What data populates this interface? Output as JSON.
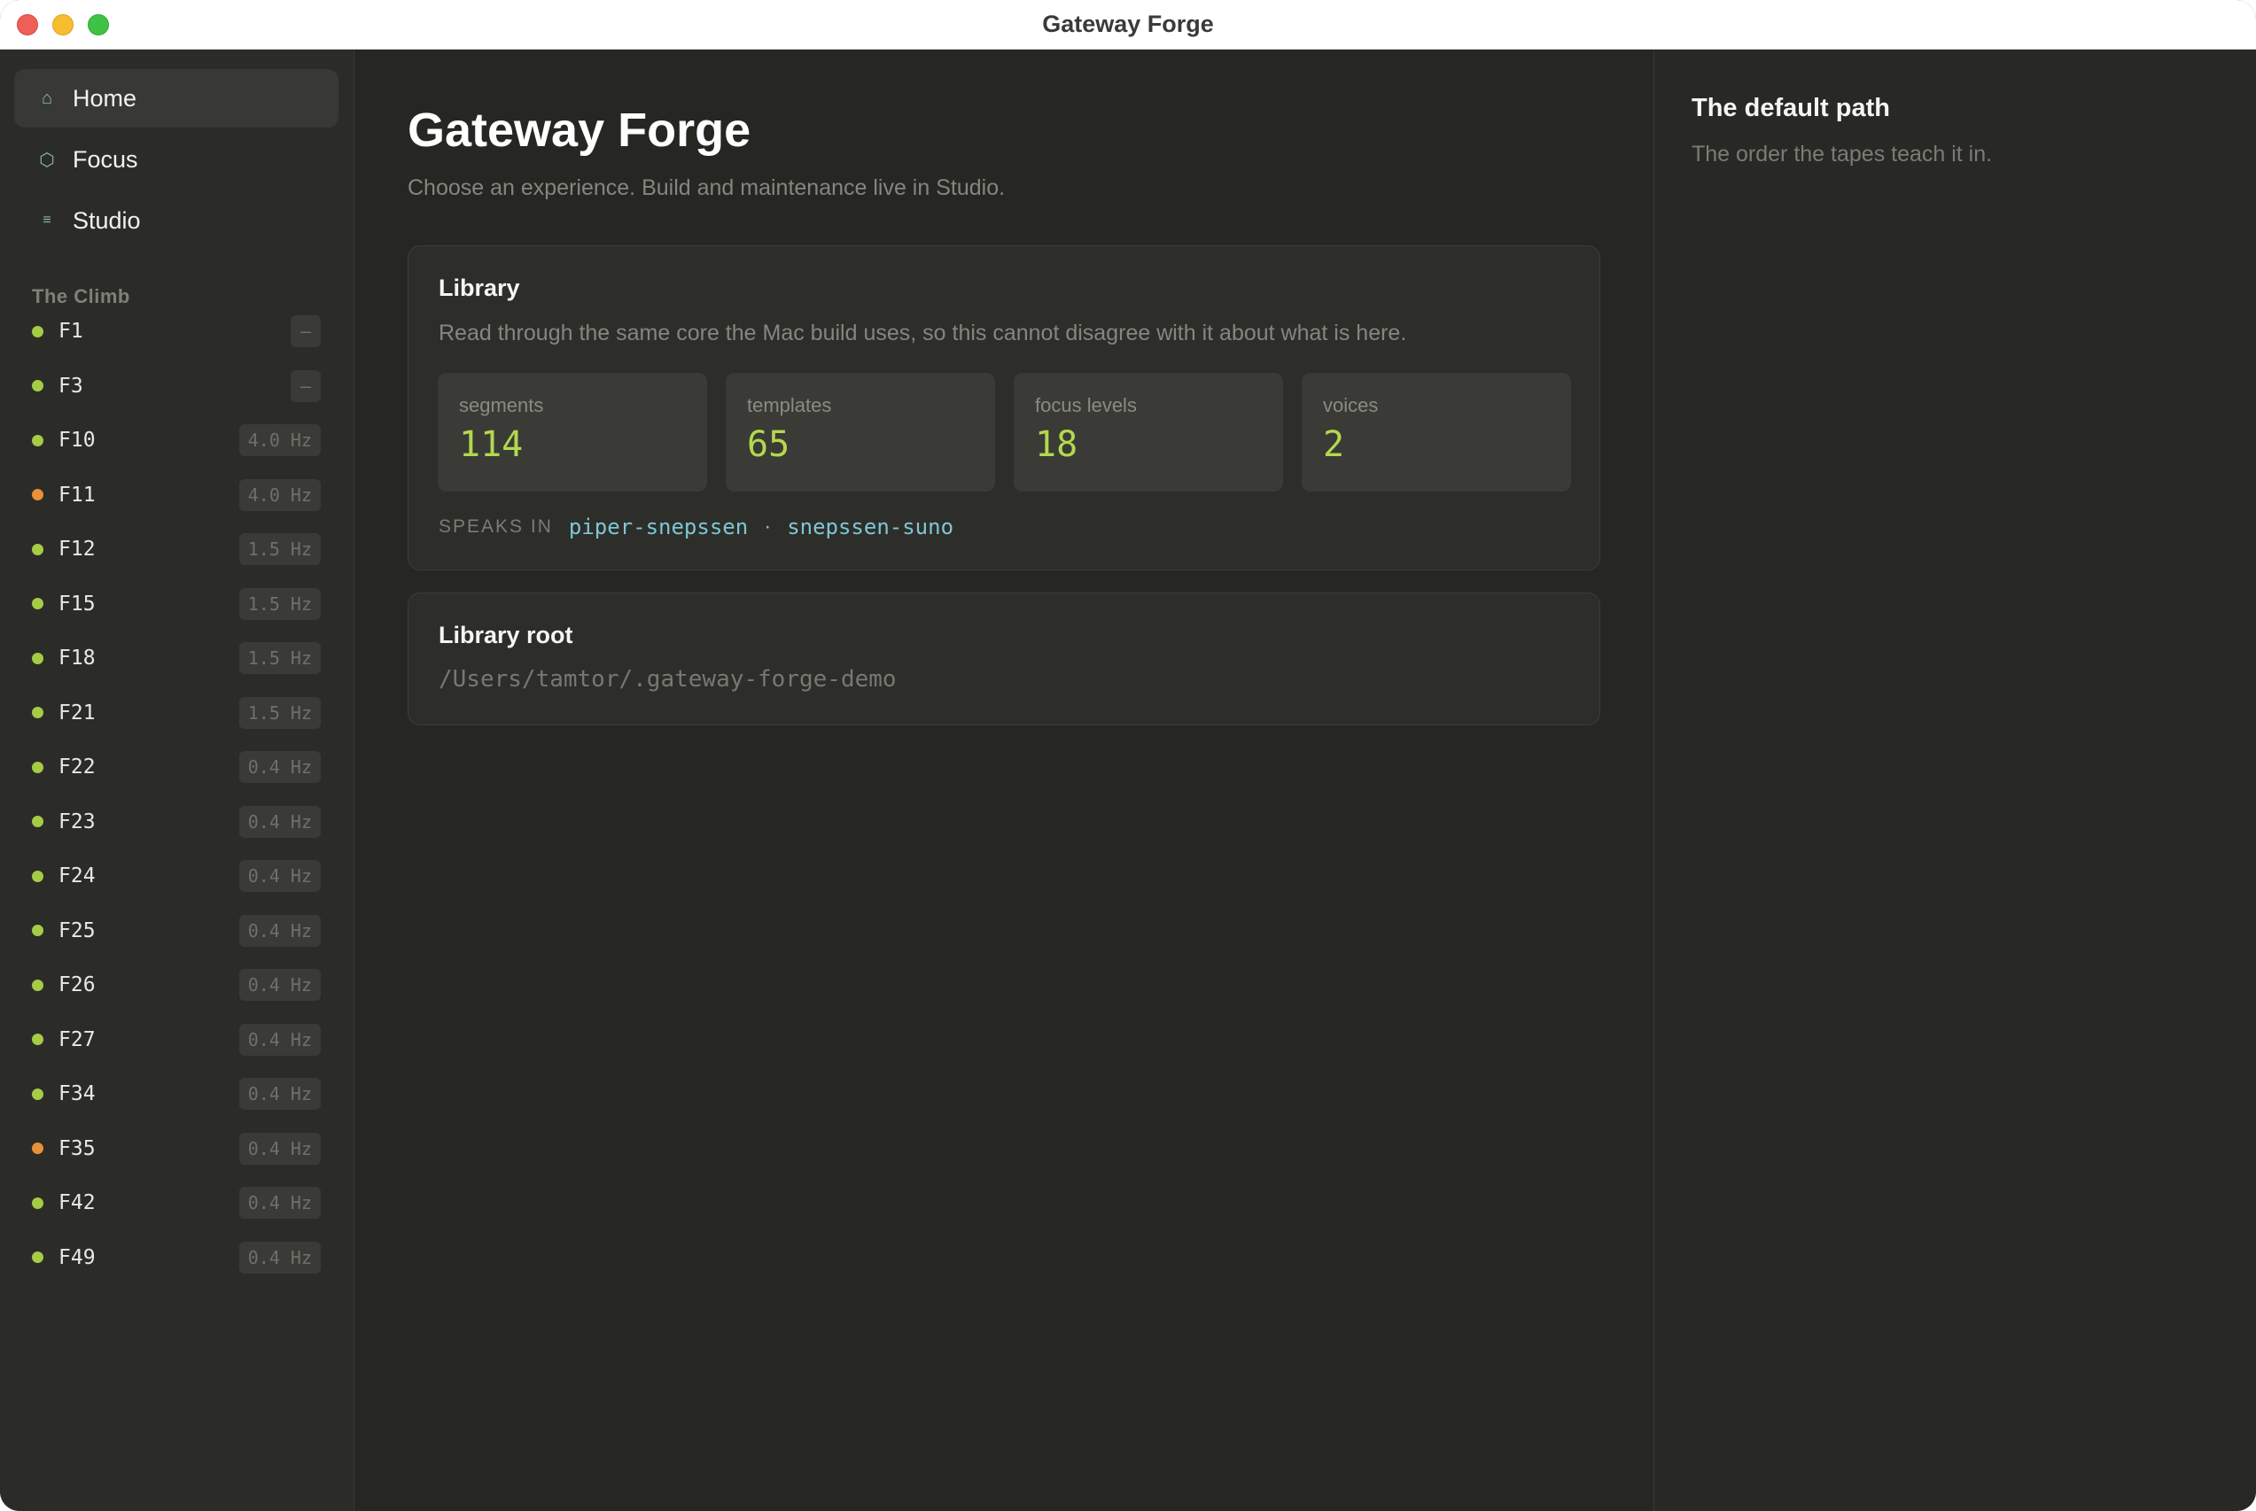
{
  "window": {
    "title": "Gateway Forge"
  },
  "sidebar": {
    "nav": [
      {
        "label": "Home",
        "icon": "home-icon",
        "glyph": "⌂",
        "active": true
      },
      {
        "label": "Focus",
        "icon": "hexagon-icon",
        "glyph": "⬡",
        "active": false
      },
      {
        "label": "Studio",
        "icon": "lines-icon",
        "glyph": "≡",
        "active": false
      }
    ],
    "section_title": "The Climb",
    "levels": [
      {
        "name": "F1",
        "badge": "–",
        "status": "ok"
      },
      {
        "name": "F3",
        "badge": "–",
        "status": "ok"
      },
      {
        "name": "F10",
        "badge": "4.0 Hz",
        "status": "ok"
      },
      {
        "name": "F11",
        "badge": "4.0 Hz",
        "status": "warn"
      },
      {
        "name": "F12",
        "badge": "1.5 Hz",
        "status": "ok"
      },
      {
        "name": "F15",
        "badge": "1.5 Hz",
        "status": "ok"
      },
      {
        "name": "F18",
        "badge": "1.5 Hz",
        "status": "ok"
      },
      {
        "name": "F21",
        "badge": "1.5 Hz",
        "status": "ok"
      },
      {
        "name": "F22",
        "badge": "0.4 Hz",
        "status": "ok"
      },
      {
        "name": "F23",
        "badge": "0.4 Hz",
        "status": "ok"
      },
      {
        "name": "F24",
        "badge": "0.4 Hz",
        "status": "ok"
      },
      {
        "name": "F25",
        "badge": "0.4 Hz",
        "status": "ok"
      },
      {
        "name": "F26",
        "badge": "0.4 Hz",
        "status": "ok"
      },
      {
        "name": "F27",
        "badge": "0.4 Hz",
        "status": "ok"
      },
      {
        "name": "F34",
        "badge": "0.4 Hz",
        "status": "ok"
      },
      {
        "name": "F35",
        "badge": "0.4 Hz",
        "status": "warn"
      },
      {
        "name": "F42",
        "badge": "0.4 Hz",
        "status": "ok"
      },
      {
        "name": "F49",
        "badge": "0.4 Hz",
        "status": "ok"
      }
    ]
  },
  "main": {
    "title": "Gateway Forge",
    "subtitle": "Choose an experience. Build and maintenance live in Studio.",
    "library": {
      "title": "Library",
      "description": "Read through the same core the Mac build uses, so this cannot disagree with it about what is here.",
      "stats": [
        {
          "label": "segments",
          "value": "114"
        },
        {
          "label": "templates",
          "value": "65"
        },
        {
          "label": "focus levels",
          "value": "18"
        },
        {
          "label": "voices",
          "value": "2"
        }
      ],
      "speaks_label": "SPEAKS IN",
      "voices": [
        "piper-snepssen",
        "snepssen-suno"
      ],
      "voice_separator": "·"
    },
    "library_root": {
      "title": "Library root",
      "path": "/Users/tamtor/.gateway-forge-demo"
    }
  },
  "right_panel": {
    "title": "The default path",
    "subtitle": "The order the tapes teach it in."
  },
  "colors": {
    "accent_green": "#b3d84f",
    "status_ok": "#a6cc45",
    "status_warn": "#e8903a",
    "link_cyan": "#7fc6d4"
  }
}
